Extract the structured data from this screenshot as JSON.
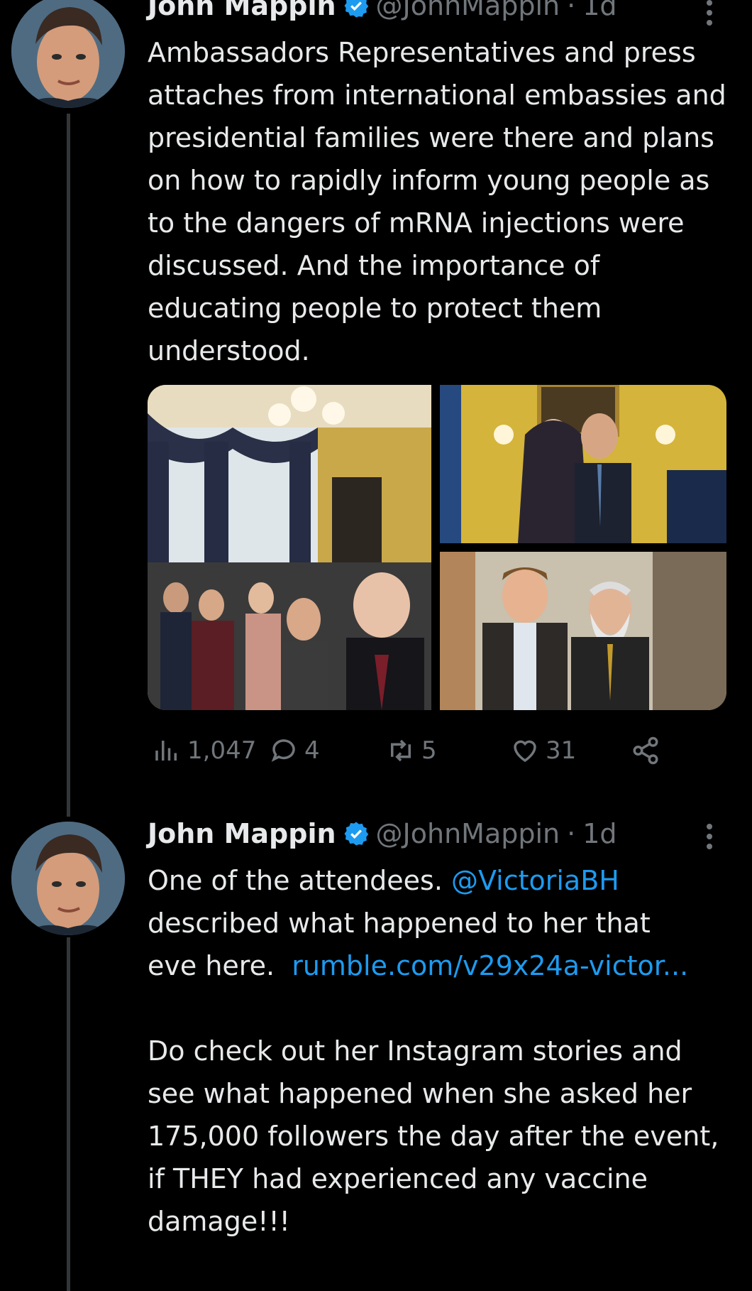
{
  "tweets": [
    {
      "display_name": "John Mappin",
      "handle": "@JohnMappin",
      "time": "1d",
      "text": "Ambassadors Representatives and press attaches from international embassies and presidential families were there and plans on how to rapidly inform young people as to the dangers of mRNA injections were discussed. And the importance of educating people to protect them understood.",
      "stats": {
        "views": "1,047",
        "replies": "4",
        "retweets": "5",
        "likes": "31"
      }
    },
    {
      "display_name": "John Mappin",
      "handle": "@JohnMappin",
      "time": "1d",
      "text_part1": "One of the attendees. ",
      "mention": "@VictoriaBH",
      "text_part2": "\ndescribed what happened to her that\neve here.  ",
      "link": "rumble.com/v29x24a-victor...",
      "text_part3": "\n\nDo check out her Instagram stories and see what happened when she asked her 175,000 followers the day after the event, if THEY had experienced any vaccine damage!!!"
    }
  ],
  "icons": {
    "verified": "verified-badge-icon",
    "more": "more-vertical-icon",
    "views": "analytics-icon",
    "reply": "reply-icon",
    "retweet": "retweet-icon",
    "like": "heart-icon",
    "share": "share-icon"
  },
  "colors": {
    "accent": "#1d9bf0",
    "background": "#000000",
    "secondary_text": "#71767b"
  }
}
